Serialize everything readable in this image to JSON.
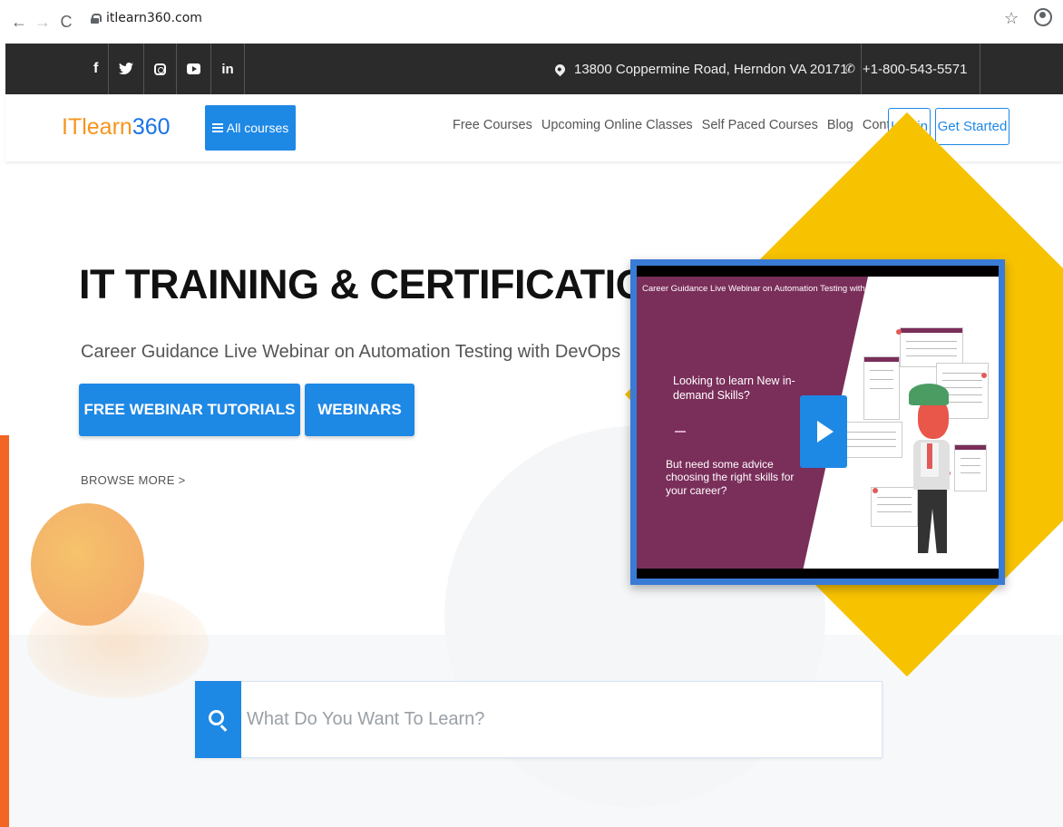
{
  "browser": {
    "url": "itlearn360.com",
    "back": "←",
    "forward": "→",
    "reload": "C",
    "star": "☆"
  },
  "topbar": {
    "social": [
      "f",
      "y",
      "ig",
      "yt",
      "in"
    ],
    "address": "13800 Coppermine Road, Herndon VA 20171",
    "phone": "+1-800-543-5571",
    "phone_glyph": "✆"
  },
  "header": {
    "logo_text": "ITlearn",
    "logo_num": "360",
    "all_courses": "All courses",
    "nav": [
      "Free Courses",
      "Upcoming Online Classes",
      "Self Paced Courses",
      "Blog",
      "Contact Us"
    ],
    "login": "Log in",
    "get_started": "Get Started"
  },
  "hero": {
    "title": "IT TRAINING & CERTIFICATION",
    "subtitle": "Career Guidance Live Webinar on Automation Testing with DevOps",
    "btn_free": "FREE WEBINAR TUTORIALS",
    "btn_webinars": "WEBINARS",
    "browse_more": "BROWSE MORE >"
  },
  "video": {
    "title": "Career Guidance Live Webinar on Automation Testing with DevOps",
    "controls": "◷ ➦",
    "text1": "Looking to learn New in-demand Skills?",
    "text2": "But need some advice choosing the right skills for your career?"
  },
  "search": {
    "placeholder": "What Do You Want To Learn?"
  },
  "colors": {
    "accent": "#1e88e5",
    "logo_orange": "#f7941d",
    "diamond": "#f7c200",
    "topbar": "#2b2b2b"
  }
}
